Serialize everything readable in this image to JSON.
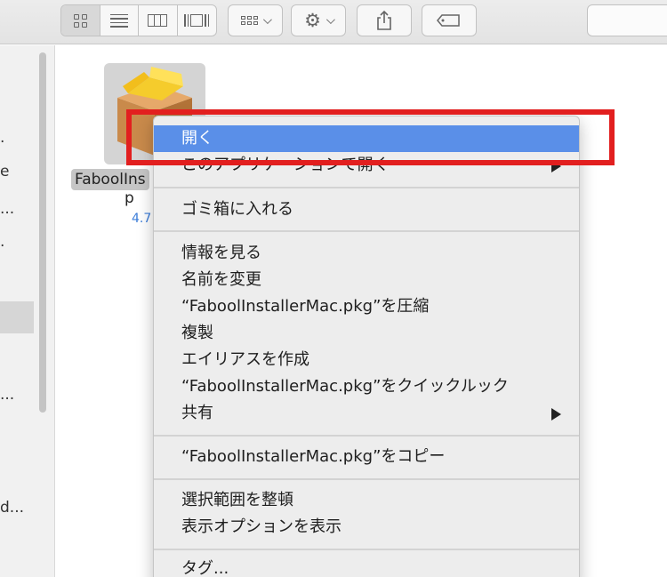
{
  "toolbar": {
    "view_modes": [
      "icon-view",
      "list-view",
      "column-view",
      "coverflow-view"
    ],
    "arrange_icon": "arrange-icon",
    "action_icon": "gear-icon",
    "share_icon": "share-icon",
    "tag_icon": "tag-icon"
  },
  "sidebar": {
    "fragments": [
      ".",
      "e",
      "...",
      ".",
      "...",
      "d..."
    ]
  },
  "file": {
    "name_line1": "FaboolIns",
    "name_line2": "p",
    "size": "4.7"
  },
  "context_menu": {
    "open": "開く",
    "open_with": "このアプリケーションで開く",
    "trash": "ゴミ箱に入れる",
    "get_info": "情報を見る",
    "rename": "名前を変更",
    "compress": "“FaboolInstallerMac.pkg”を圧縮",
    "duplicate": "複製",
    "make_alias": "エイリアスを作成",
    "quick_look": "“FaboolInstallerMac.pkg”をクイックルック",
    "share": "共有",
    "copy": "“FaboolInstallerMac.pkg”をコピー",
    "clean_up": "選択範囲を整頓",
    "view_options": "表示オプションを表示",
    "tags": "タグ..."
  },
  "colors": {
    "highlight": "#5a8fe8",
    "annotation": "#e21f1f"
  }
}
